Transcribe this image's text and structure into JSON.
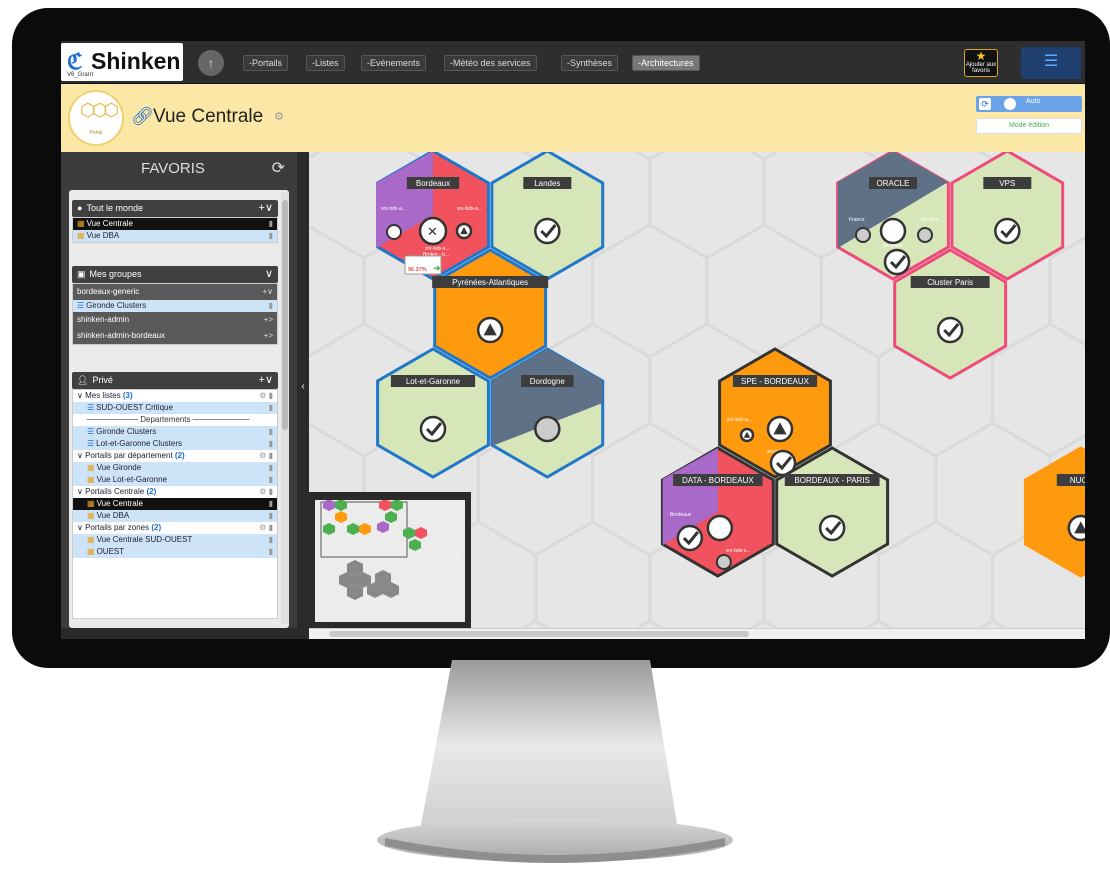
{
  "app": {
    "logo_text": "Shinken",
    "logo_sub": "V6_Grarrr"
  },
  "nav": {
    "items": [
      "-Portails",
      "-Listes",
      "-Evénements",
      "-Météo des services",
      "-Synthèses",
      "-Architectures"
    ],
    "favorite_button": "Ajouter aux favoris"
  },
  "header": {
    "title": "Vue Centrale",
    "portal_label": "Portal",
    "auto_label": "Auto",
    "mode_button": "Mode édition"
  },
  "sidebar": {
    "title": "FAVORIS",
    "groups": {
      "everyone": {
        "title": "Tout le monde",
        "items": [
          "Vue Centrale",
          "Vue DBA"
        ]
      },
      "mygroups": {
        "title": "Mes groupes",
        "items": [
          "bordeaux-generic",
          "Gironde Clusters",
          "shinken-admin",
          "shinken-admin-bordeaux"
        ]
      },
      "private": {
        "title": "Privé",
        "my_lists": "Mes listes",
        "my_lists_count": "(3)",
        "list_items": [
          "SUD-OUEST Critique",
          "Departements",
          "Gironde Clusters",
          "Lot-et-Garonne Clusters"
        ],
        "by_dept": "Portails par département",
        "by_dept_count": "(2)",
        "dept_items": [
          "Vue Gironde",
          "Vue Lot-et-Garonne"
        ],
        "central": "Portails Centrale",
        "central_count": "(2)",
        "central_items": [
          "Vue Centrale",
          "Vue DBA"
        ],
        "zones": "Portails par zones",
        "zones_count": "(2)",
        "zone_items": [
          "Vue Centrale SUD-OUEST",
          "OUEST"
        ]
      }
    }
  },
  "map": {
    "hexes": {
      "bordeaux": "Bordeaux",
      "landes": "Landes",
      "pyrenees": "Pyrénées-Atlantiques",
      "lotgaronne": "Lot-et-Garonne",
      "dordogne": "Dordogne",
      "oracle": "ORACLE",
      "vps": "VPS",
      "cluster_paris": "Cluster Paris",
      "spe_bordeaux": "SPE - BORDEAUX",
      "data_bordeaux": "DATA - BORDEAUX",
      "bordeaux_paris": "BORDEAUX - PARIS",
      "nucl": "NUCL"
    },
    "small": {
      "srv_bdx_a": "srv-bdx-a...",
      "srv_bdx_s": "srv-bdx-s...",
      "broker": "Broker - b...",
      "sla_label": "SLA",
      "sla_value": "96.37%",
      "france": "France",
      "srv_lyon": "srv-lyon-...",
      "srv_paris": "srv-paris-...",
      "bordeaux_small": "Bordeaux",
      "srv_bdx_s2": "srv-bdx-s..."
    }
  },
  "colors": {
    "ok": "#d7e6b9",
    "warning": "#ff9a0f",
    "critical": "#f1525d",
    "unknown": "#a869c9",
    "gray": "#5f7186",
    "blue_border": "#1f77c9",
    "pink_border": "#ee4b7a",
    "dark_border": "#333333"
  }
}
